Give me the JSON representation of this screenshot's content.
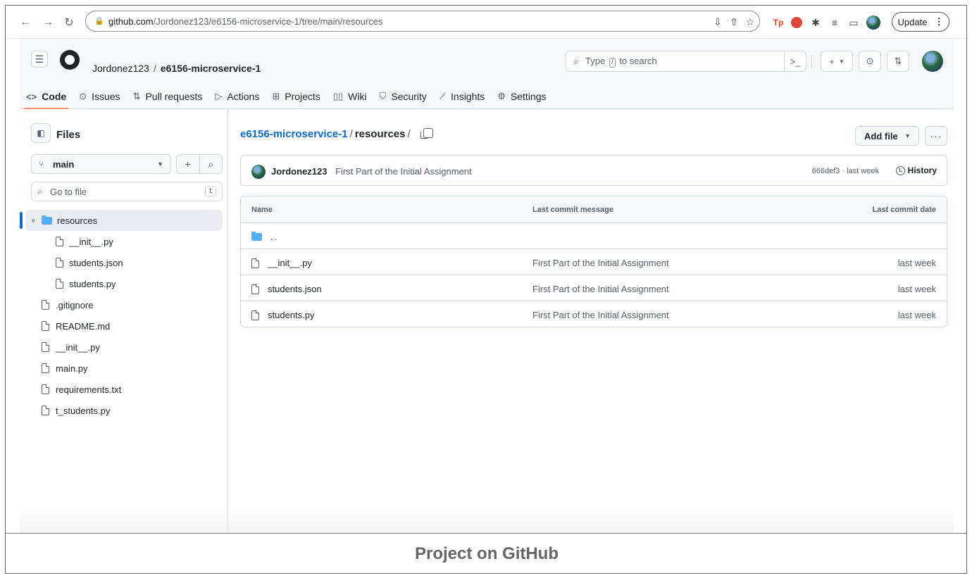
{
  "browser": {
    "url_host": "github.com",
    "url_path": "/Jordonez123/e6156-microservice-1/tree/main/resources",
    "update_label": "Update",
    "icons": [
      "back-icon",
      "forward-icon",
      "reload-icon",
      "lock-icon",
      "install-icon",
      "share-icon",
      "star-icon",
      "tp-extension-icon",
      "adblock-icon",
      "extensions-icon",
      "reading-list-icon",
      "side-panel-icon",
      "profile-icon",
      "kebab-icon"
    ]
  },
  "gh_header": {
    "owner": "Jordonez123",
    "separator": "/",
    "repo": "e6156-microservice-1",
    "search_placeholder_prefix": "Type",
    "search_key": "/",
    "search_placeholder_suffix": "to search"
  },
  "repo_tabs": [
    {
      "label": "Code",
      "icon": "code-icon",
      "active": true
    },
    {
      "label": "Issues",
      "icon": "issue-icon"
    },
    {
      "label": "Pull requests",
      "icon": "pull-request-icon"
    },
    {
      "label": "Actions",
      "icon": "play-icon"
    },
    {
      "label": "Projects",
      "icon": "table-icon"
    },
    {
      "label": "Wiki",
      "icon": "book-icon"
    },
    {
      "label": "Security",
      "icon": "shield-icon"
    },
    {
      "label": "Insights",
      "icon": "graph-icon"
    },
    {
      "label": "Settings",
      "icon": "gear-icon"
    }
  ],
  "sidebar": {
    "title": "Files",
    "branch": "main",
    "goto_placeholder": "Go to file",
    "goto_key": "t",
    "tree": [
      {
        "label": "resources",
        "type": "folder",
        "selected": true
      },
      {
        "label": "__init__.py",
        "type": "file",
        "child": true
      },
      {
        "label": "students.json",
        "type": "file",
        "child": true
      },
      {
        "label": "students.py",
        "type": "file",
        "child": true
      },
      {
        "label": ".gitignore",
        "type": "file"
      },
      {
        "label": "README.md",
        "type": "file"
      },
      {
        "label": "__init__.py",
        "type": "file"
      },
      {
        "label": "main.py",
        "type": "file"
      },
      {
        "label": "requirements.txt",
        "type": "file"
      },
      {
        "label": "t_students.py",
        "type": "file"
      }
    ]
  },
  "main": {
    "repo_link": "e6156-microservice-1",
    "path_sep": "/",
    "current_dir": "resources",
    "trailing_sep": "/",
    "add_file_label": "Add file",
    "more_label": "···",
    "commit": {
      "author": "Jordonez123",
      "message": "First Part of the Initial Assignment",
      "meta": "666def3 · last week",
      "history_label": "History"
    },
    "table": {
      "headers": {
        "name": "Name",
        "message": "Last commit message",
        "date": "Last commit date"
      },
      "parent_label": "..",
      "rows": [
        {
          "name": "__init__.py",
          "message": "First Part of the Initial Assignment",
          "date": "last week"
        },
        {
          "name": "students.json",
          "message": "First Part of the Initial Assignment",
          "date": "last week"
        },
        {
          "name": "students.py",
          "message": "First Part of the Initial Assignment",
          "date": "last week"
        }
      ]
    }
  },
  "caption": "Project on GitHub",
  "colors": {
    "accent_link": "#0969da",
    "tab_underline": "#fd8c73",
    "folder": "#54aeff"
  }
}
